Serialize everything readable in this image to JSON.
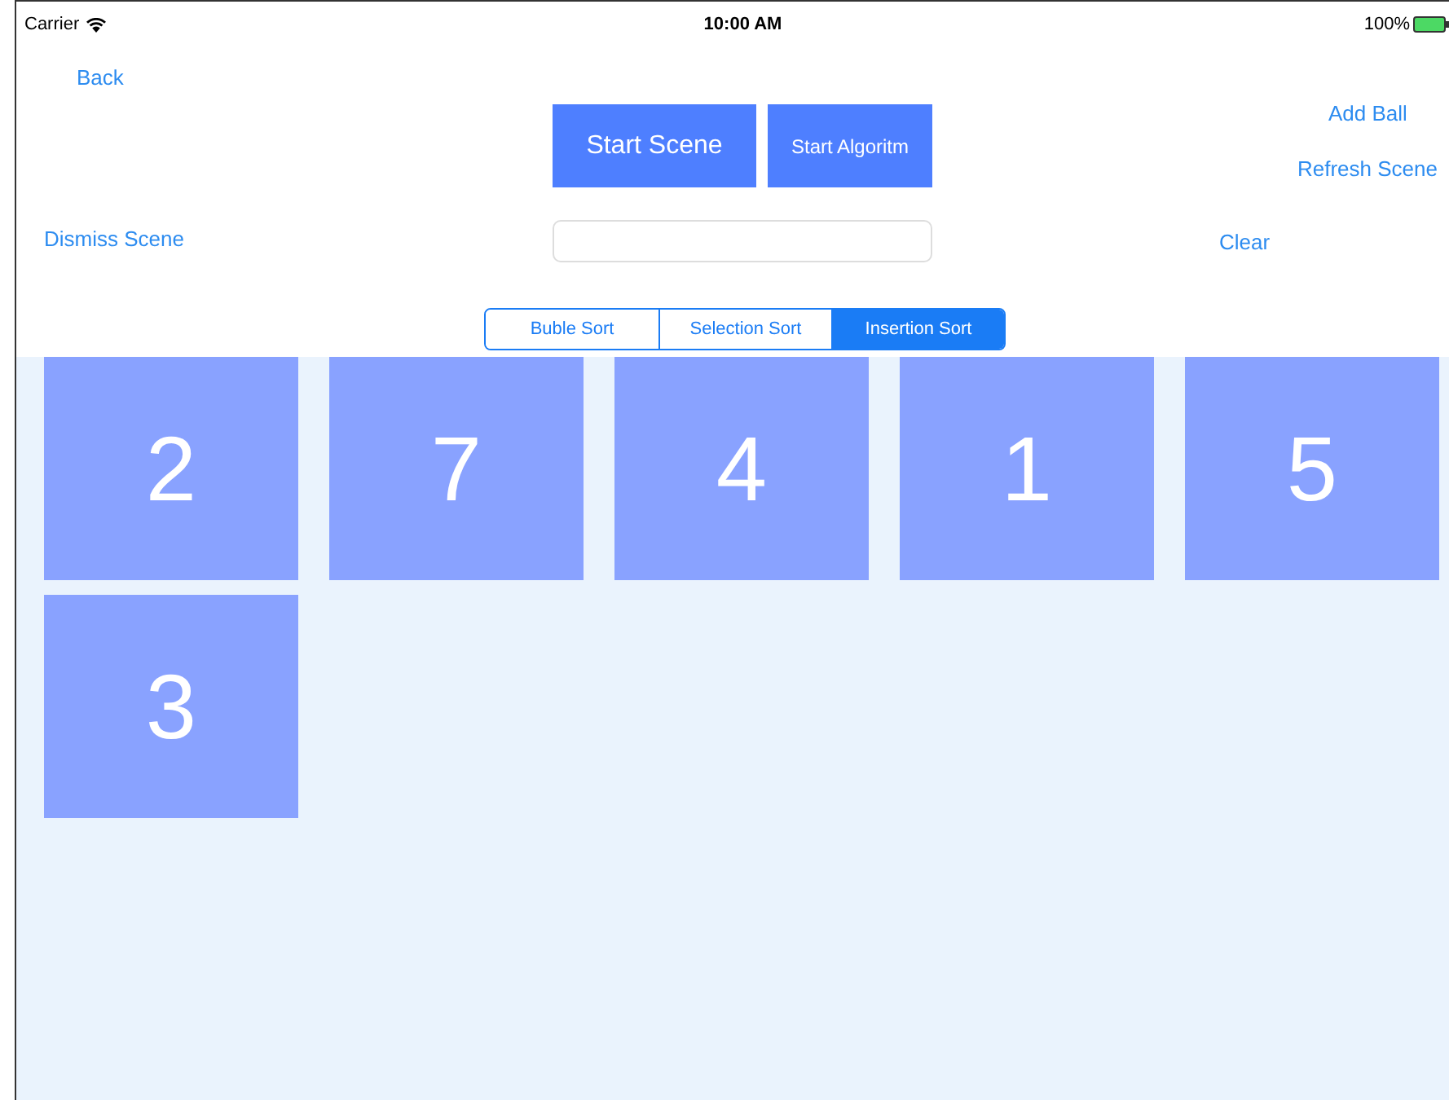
{
  "status_bar": {
    "carrier": "Carrier",
    "time": "10:00 AM",
    "battery": "100%"
  },
  "nav": {
    "back": "Back",
    "dismiss": "Dismiss Scene",
    "add_ball": "Add Ball",
    "refresh": "Refresh Scene",
    "clear": "Clear"
  },
  "buttons": [
    {
      "label": "Start Scene",
      "kind": "large"
    },
    {
      "label": "Start Algoritm",
      "kind": "small"
    }
  ],
  "segments": [
    {
      "label": "Buble Sort",
      "selected": false
    },
    {
      "label": "Selection Sort",
      "selected": false
    },
    {
      "label": "Insertion Sort",
      "selected": true
    }
  ],
  "tiles": [
    "2",
    "7",
    "4",
    "1",
    "5",
    "3"
  ]
}
